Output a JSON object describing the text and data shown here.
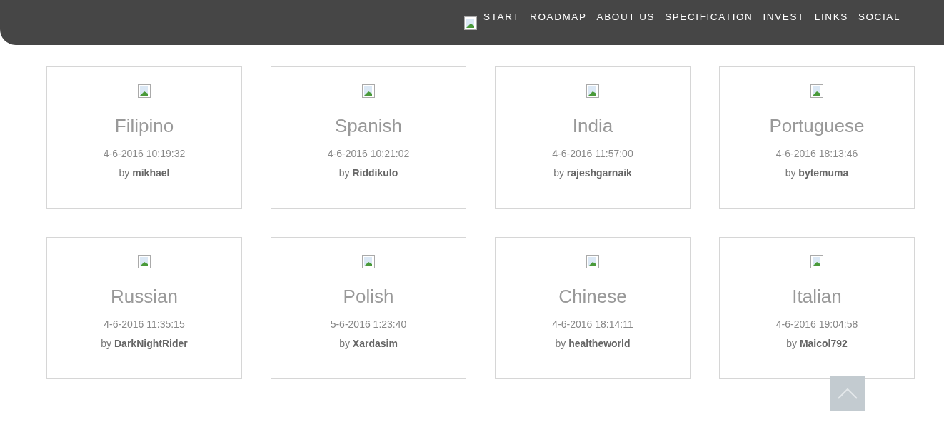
{
  "nav": {
    "items": [
      "START",
      "ROADMAP",
      "ABOUT US",
      "SPECIFICATION",
      "INVEST",
      "LINKS",
      "SOCIAL"
    ]
  },
  "cards": [
    {
      "title": "Filipino",
      "date": "4-6-2016 10:19:32",
      "author": "by **mikhael**"
    },
    {
      "title": "Spanish",
      "date": "4-6-2016 10:21:02",
      "author": "by **Riddikulo**"
    },
    {
      "title": "India",
      "date": "4-6-2016 11:57:00",
      "author": "by **rajeshgarnaik**"
    },
    {
      "title": "Portuguese",
      "date": "4-6-2016 18:13:46",
      "author": "by **bytemuma**"
    },
    {
      "title": "Russian",
      "date": "4-6-2016 11:35:15",
      "author": "by **DarkNightRider**"
    },
    {
      "title": "Polish",
      "date": "5-6-2016 1:23:40",
      "author": "by **Xardasim**"
    },
    {
      "title": "Chinese",
      "date": "4-6-2016 18:14:11",
      "author": "by **healtheworld**"
    },
    {
      "title": "Italian",
      "date": "4-6-2016 19:04:58",
      "author": "by **Maicol792**"
    }
  ]
}
